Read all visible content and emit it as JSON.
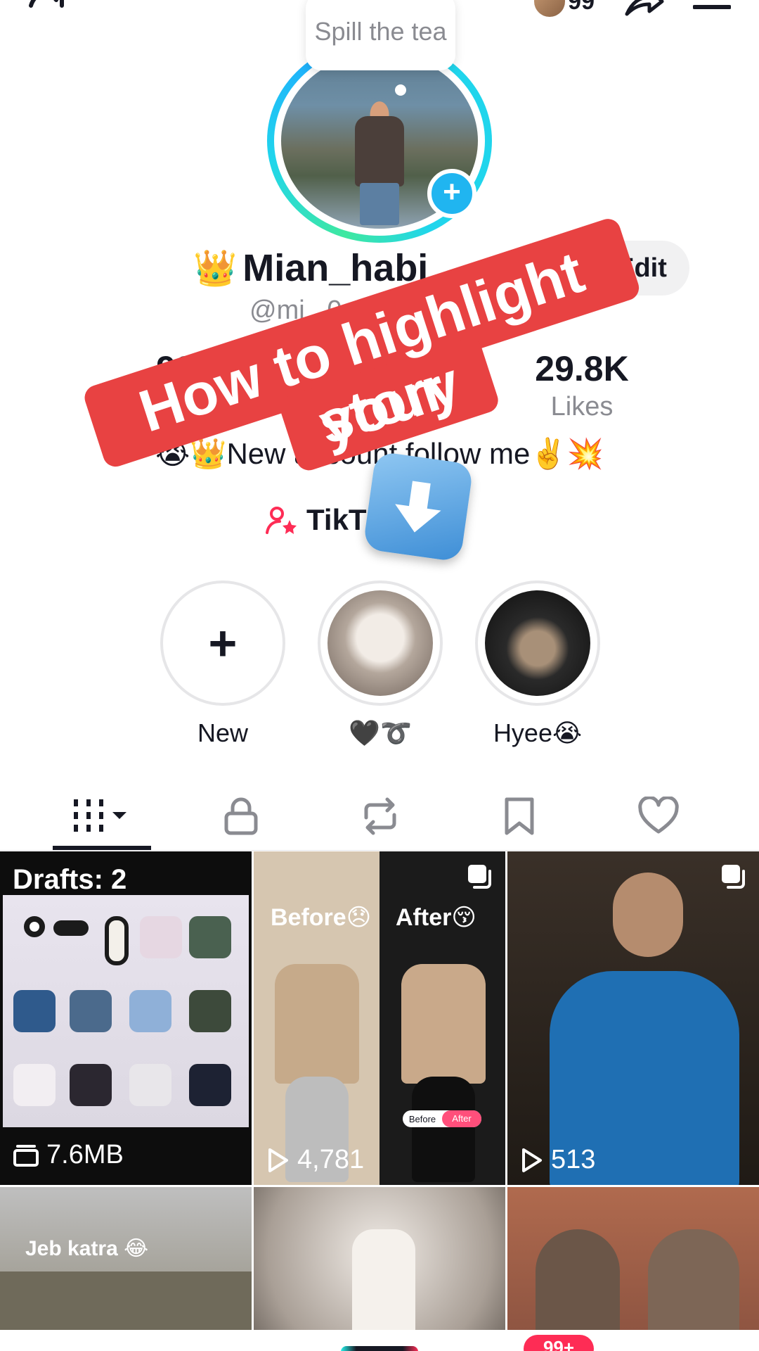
{
  "bubble": {
    "text": "Spill the tea"
  },
  "top_bar": {
    "friends_count": "99"
  },
  "profile": {
    "crown_emoji": "👑",
    "display_name": "Mian_habi",
    "handle": "@mi                         _0",
    "edit_label": "Edit"
  },
  "stats": {
    "following_value": "99",
    "followers_label": "s",
    "likes_value": "29.8K",
    "likes_label": "Likes"
  },
  "bio": {
    "text": "😭👑New account follow me✌️💥"
  },
  "studio": {
    "label": "TikT          io"
  },
  "caption": {
    "line1": "How to highlight your",
    "line2": "story"
  },
  "highlights": [
    {
      "label": "New"
    },
    {
      "label": "🖤➰"
    },
    {
      "label": "Hyee😭"
    }
  ],
  "grid": {
    "drafts_label": "Drafts: 2",
    "drafts_size": "7.6MB",
    "cell2_before": "Before😞",
    "cell2_after": "After😚",
    "cell2_toggle_before": "Before",
    "cell2_toggle_after": "After",
    "cell2_views": "4,781",
    "cell3_views": "513",
    "cell4_text": "Jeb katra 😂"
  },
  "bottom_nav": {
    "inbox_badge": "99+"
  },
  "colors": {
    "accent_pink": "#fe2c55",
    "accent_cyan": "#20d5ec",
    "caption_red": "#e84242"
  }
}
